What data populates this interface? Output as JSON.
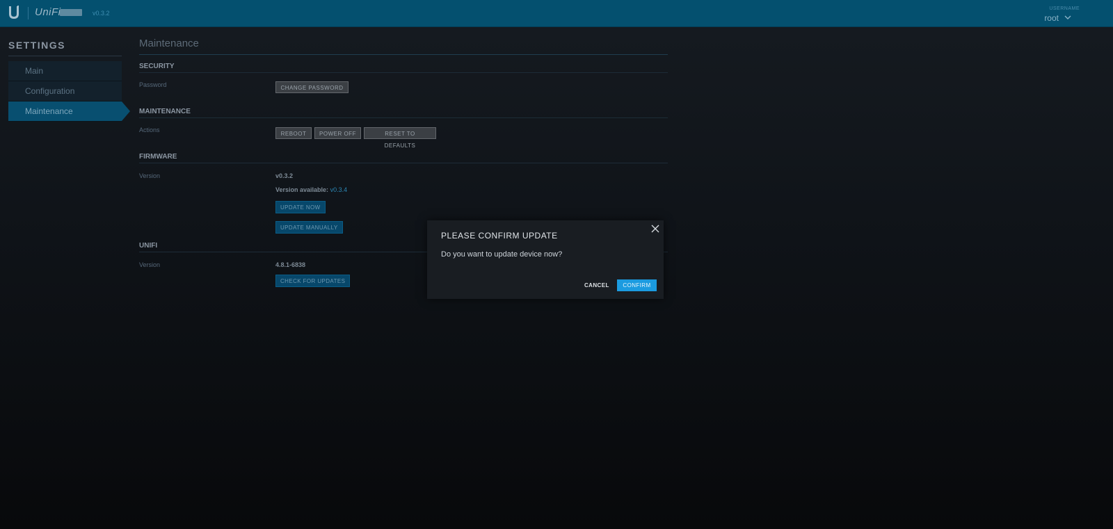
{
  "header": {
    "brand": "UniFi",
    "version": "v0.3.2",
    "user_caption": "USERNAME",
    "username": "root"
  },
  "sidebar": {
    "title": "SETTINGS",
    "items": [
      {
        "label": "Main"
      },
      {
        "label": "Configuration"
      },
      {
        "label": "Maintenance",
        "active": true
      }
    ]
  },
  "main": {
    "title": "Maintenance",
    "security": {
      "heading": "SECURITY",
      "password_label": "Password",
      "change_password_button": "CHANGE PASSWORD"
    },
    "maintenance": {
      "heading": "MAINTENANCE",
      "actions_label": "Actions",
      "reboot_button": "REBOOT",
      "power_off_button": "POWER OFF",
      "reset_button": "RESET TO DEFAULTS"
    },
    "firmware": {
      "heading": "FIRMWARE",
      "version_label": "Version",
      "version": "v0.3.2",
      "available_prefix": "Version available:",
      "available_version": "v0.3.4",
      "update_now_button": "UPDATE NOW",
      "update_manually_button": "UPDATE MANUALLY"
    },
    "unifi": {
      "heading": "UNIFI",
      "version_label": "Version",
      "version": "4.8.1-6838",
      "check_updates_button": "CHECK FOR UPDATES"
    }
  },
  "modal": {
    "title": "PLEASE CONFIRM UPDATE",
    "message": "Do you want to update device now?",
    "cancel": "CANCEL",
    "confirm": "CONFIRM"
  },
  "colors": {
    "topbar": "#04506f",
    "accent": "#1b9be0",
    "sidebar_active": "#084f70"
  }
}
